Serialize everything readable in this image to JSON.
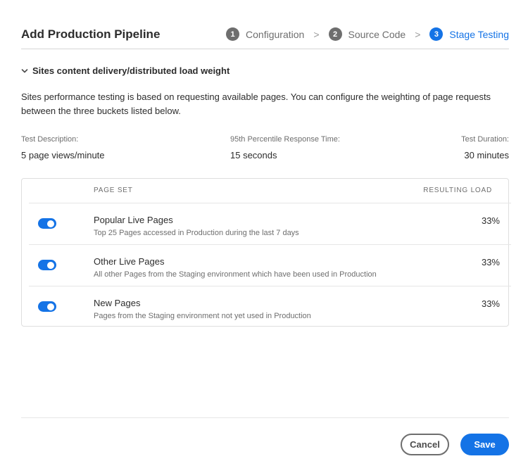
{
  "header": {
    "title": "Add Production Pipeline",
    "steps": [
      {
        "num": "1",
        "label": "Configuration"
      },
      {
        "num": "2",
        "label": "Source Code"
      },
      {
        "num": "3",
        "label": "Stage Testing"
      }
    ],
    "chevron": ">"
  },
  "section": {
    "title": "Sites content delivery/distributed load weight",
    "description": "Sites performance testing is based on requesting available pages. You can configure the weighting of page requests between the three buckets listed below."
  },
  "metrics": {
    "test_description": {
      "label": "Test Description:",
      "value": "5 page views/minute"
    },
    "response_time": {
      "label": "95th Percentile Response Time:",
      "value": "15 seconds"
    },
    "test_duration": {
      "label": "Test Duration:",
      "value": "30 minutes"
    }
  },
  "table": {
    "columns": {
      "page_set": "PAGE SET",
      "resulting_load": "RESULTING LOAD"
    },
    "rows": [
      {
        "title": "Popular Live Pages",
        "subtitle": "Top 25 Pages accessed in Production during the last 7 days",
        "load": "33%",
        "enabled": true
      },
      {
        "title": "Other Live Pages",
        "subtitle": "All other Pages from the Staging environment which have been used in Production",
        "load": "33%",
        "enabled": true
      },
      {
        "title": "New Pages",
        "subtitle": "Pages from the Staging environment not yet used in Production",
        "load": "33%",
        "enabled": true
      }
    ]
  },
  "footer": {
    "cancel_label": "Cancel",
    "save_label": "Save"
  },
  "colors": {
    "accent": "#1473e6",
    "step_inactive": "#6e6e6e",
    "text": "#2c2c2c"
  }
}
